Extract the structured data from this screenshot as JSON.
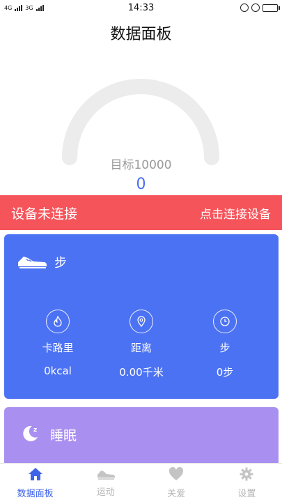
{
  "status_bar": {
    "time": "14:33",
    "network_a": "4G",
    "network_b": "3G"
  },
  "header": {
    "title": "数据面板"
  },
  "gauge": {
    "target_label": "目标10000",
    "current_value": "0",
    "progress": 0
  },
  "connection_banner": {
    "status": "设备未连接",
    "action": "点击连接设备"
  },
  "steps_card": {
    "title": "步",
    "metrics": [
      {
        "name": "卡路里",
        "value": "0kcal",
        "icon": "flame-icon"
      },
      {
        "name": "距离",
        "value": "0.00千米",
        "icon": "location-pin-icon"
      },
      {
        "name": "步",
        "value": "0步",
        "icon": "clock-icon"
      }
    ]
  },
  "sleep_card": {
    "title": "睡眠"
  },
  "tabbar": {
    "items": [
      {
        "label": "数据面板",
        "icon": "home-icon",
        "active": true
      },
      {
        "label": "运动",
        "icon": "shoe-icon",
        "active": false
      },
      {
        "label": "关爱",
        "icon": "heart-icon",
        "active": false
      },
      {
        "label": "设置",
        "icon": "gear-icon",
        "active": false
      }
    ]
  },
  "colors": {
    "accent": "#4c72f4",
    "alert": "#f5545b",
    "sleep": "#a98ff0",
    "tab_active": "#3f63e8"
  }
}
